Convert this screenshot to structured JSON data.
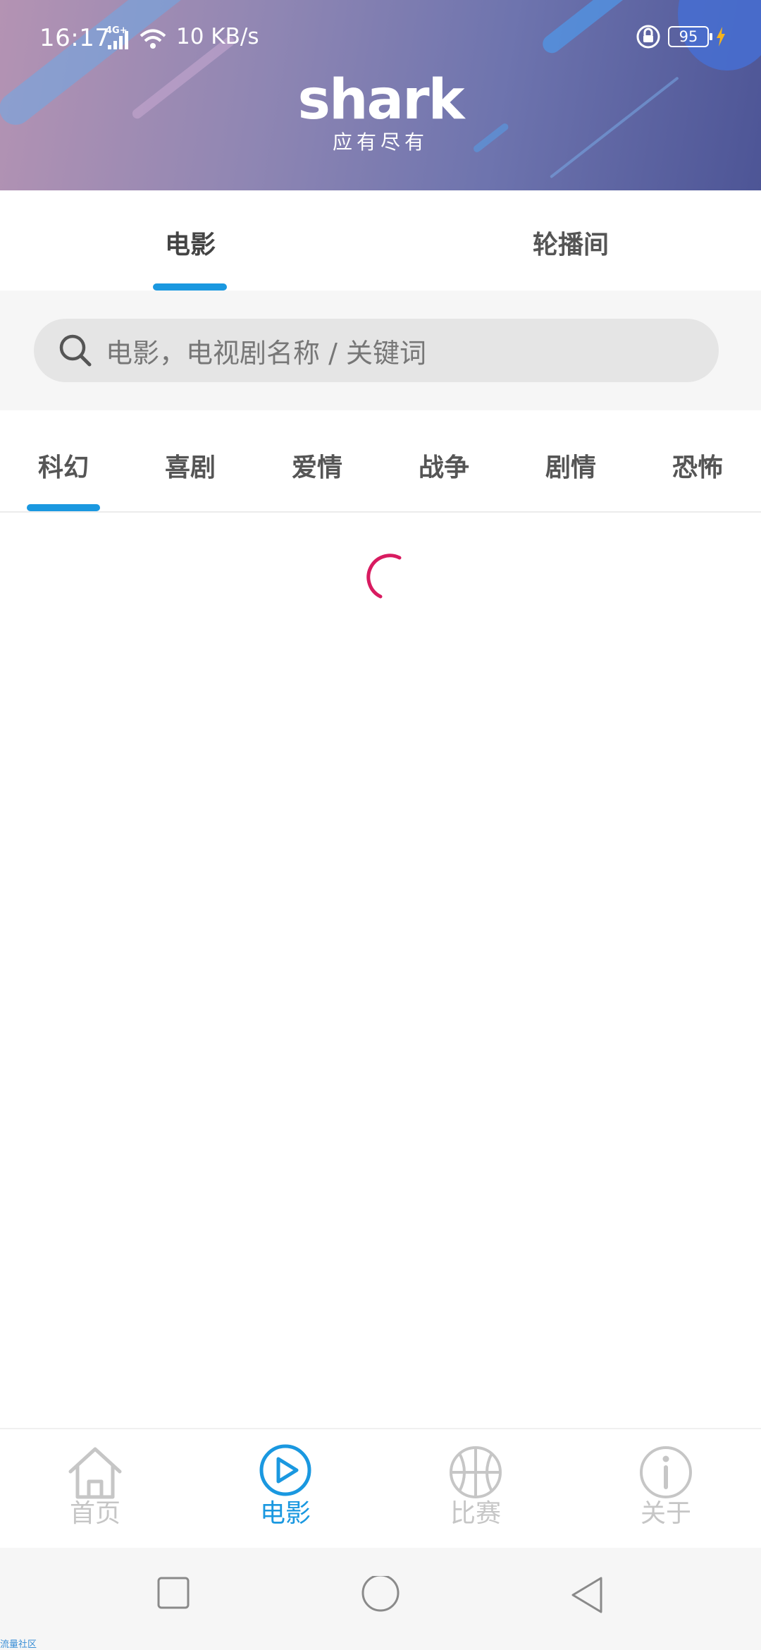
{
  "status_bar": {
    "time": "16:17",
    "network": "4G+",
    "speed": "10 KB/s",
    "battery": "95"
  },
  "header": {
    "logo_text": "shark",
    "slogan": "应有尽有"
  },
  "top_tabs": [
    {
      "label": "电影",
      "active": true
    },
    {
      "label": "轮播间",
      "active": false
    }
  ],
  "search": {
    "placeholder": "电影，电视剧名称 / 关键词"
  },
  "categories": [
    {
      "label": "科幻",
      "active": true
    },
    {
      "label": "喜剧",
      "active": false
    },
    {
      "label": "爱情",
      "active": false
    },
    {
      "label": "战争",
      "active": false
    },
    {
      "label": "剧情",
      "active": false
    },
    {
      "label": "恐怖",
      "active": false
    }
  ],
  "bottom_nav": [
    {
      "label": "首页",
      "icon": "home-icon",
      "active": false
    },
    {
      "label": "电影",
      "icon": "play-icon",
      "active": true
    },
    {
      "label": "比赛",
      "icon": "basketball-icon",
      "active": false
    },
    {
      "label": "关于",
      "icon": "info-icon",
      "active": false
    }
  ],
  "watermark": "流量社区",
  "colors": {
    "accent": "#1a98e0",
    "spinner": "#d81b60",
    "inactive": "#c6c6c6"
  }
}
